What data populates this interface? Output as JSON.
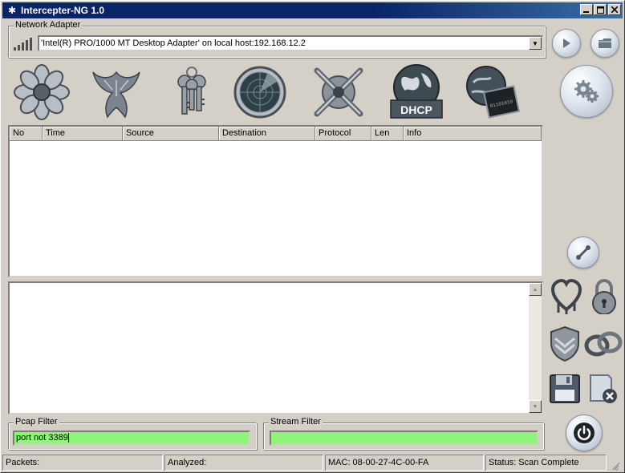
{
  "window": {
    "title": "Intercepter-NG 1.0",
    "controls": {
      "minimize": "_",
      "maximize": "□",
      "close": "×"
    }
  },
  "adapter": {
    "label": "Network Adapter",
    "selected": "'Intel(R) PRO/1000 MT Desktop Adapter' on local host:192.168.12.2"
  },
  "toolbar": {
    "icons": [
      "flower-icon",
      "phoenix-icon",
      "keys-icon",
      "radar-icon",
      "crossed-swords-icon",
      "dhcp-globe-icon",
      "network-terminal-icon"
    ],
    "dhcp_label": "DHCP"
  },
  "packet_table": {
    "columns": [
      "No",
      "Time",
      "Source",
      "Destination",
      "Protocol",
      "Len",
      "Info"
    ],
    "rows": []
  },
  "filters": {
    "pcap_label": "Pcap Filter",
    "pcap_value": "port not 3389",
    "stream_label": "Stream Filter",
    "stream_value": ""
  },
  "status": {
    "packets": "Packets:",
    "analyzed": "Analyzed:",
    "mac": "MAC: 08-00-27-4C-00-FA",
    "state": "Status: Scan Complete"
  },
  "colors": {
    "title_bar": "#0a246a",
    "filter_bg": "#8ff57a",
    "window_bg": "#d4d0c8"
  }
}
